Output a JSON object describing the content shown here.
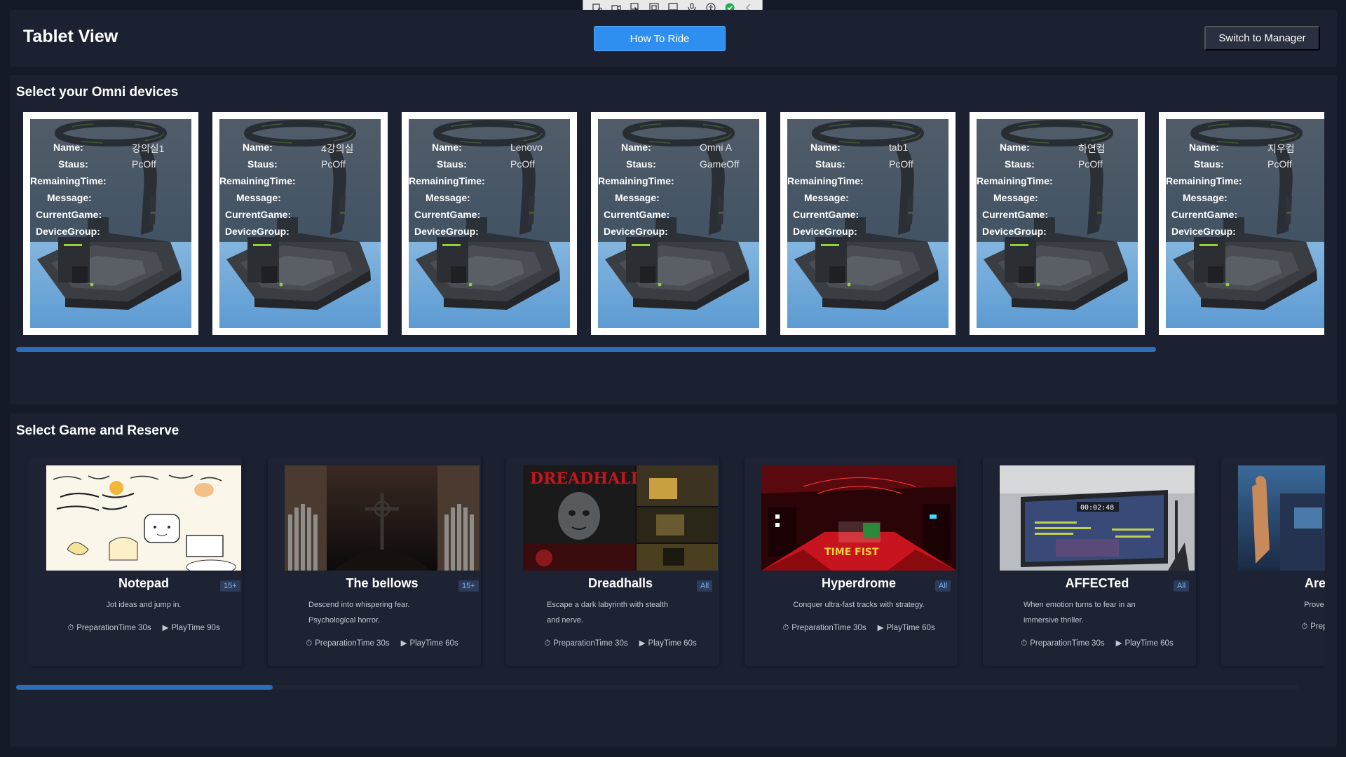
{
  "header": {
    "title": "Tablet View",
    "how_to_ride": "How To Ride",
    "switch_to_manager": "Switch to Manager"
  },
  "toolbar_icons": [
    "record-settings-icon",
    "video-camera-icon",
    "cursor-pointer-icon",
    "window-select-icon",
    "screen-share-icon",
    "microphone-icon",
    "accessibility-icon",
    "check-circle-icon",
    "chevron-left-icon"
  ],
  "devices": {
    "title": "Select your Omni devices",
    "labels": {
      "name": "Name:",
      "status": "Staus:",
      "remaining": "RemainingTime:",
      "message": "Message:",
      "current_game": "CurrentGame:",
      "device_group": "DeviceGroup:"
    },
    "items": [
      {
        "name": "강의실1",
        "status": "PcOff"
      },
      {
        "name": "4강의실",
        "status": "PcOff"
      },
      {
        "name": "Lenovo",
        "status": "PcOff"
      },
      {
        "name": "Omni A",
        "status": "GameOff"
      },
      {
        "name": "tab1",
        "status": "PcOff"
      },
      {
        "name": "하연컴",
        "status": "PcOff"
      },
      {
        "name": "지우컴",
        "status": "PcOff"
      }
    ],
    "scroll_fraction": 0.71
  },
  "games": {
    "title": "Select Game and Reserve",
    "items": [
      {
        "name": "Notepad",
        "age": "15+",
        "desc": [
          "Jot ideas and jump in."
        ],
        "prep": "PreparationTime 30s",
        "play": "PlayTime 90s"
      },
      {
        "name": "The bellows",
        "age": "15+",
        "desc": [
          "Descend into whispering fear.",
          "Psychological horror."
        ],
        "prep": "PreparationTime 30s",
        "play": "PlayTime 60s"
      },
      {
        "name": "Dreadhalls",
        "age": "All",
        "desc": [
          "Escape a dark labyrinth with stealth",
          "and nerve."
        ],
        "prep": "PreparationTime 30s",
        "play": "PlayTime 60s"
      },
      {
        "name": "Hyperdrome",
        "age": "All",
        "desc": [
          "Conquer ultra-fast tracks with strategy."
        ],
        "prep": "PreparationTime 30s",
        "play": "PlayTime 60s"
      },
      {
        "name": "AFFECTed",
        "age": "All",
        "desc": [
          "When emotion turns to fear in an",
          "immersive thriller."
        ],
        "prep": "PreparationTime 30s",
        "play": "PlayTime 60s"
      },
      {
        "name": "ArenaEx_l",
        "age": "",
        "desc": [
          "Prove skill in a har"
        ],
        "prep": "PreparationTime",
        "play": ""
      }
    ],
    "thumb_text": {
      "dreadhalls_logo": "DREADHALLS",
      "hyperdrome_sign": "TIME FIST",
      "affected_timer": "00:02:48"
    },
    "scroll_fraction": 0.2
  }
}
